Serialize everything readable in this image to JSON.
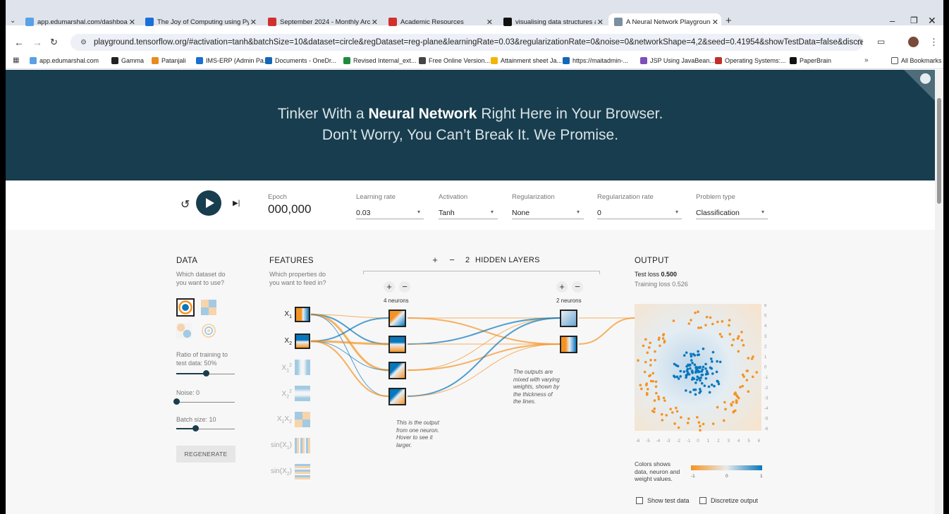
{
  "browser": {
    "tabs": [
      {
        "title": "app.edumarshal.com/dashboard",
        "color": "#5aa0e6"
      },
      {
        "title": "The Joy of Computing using Py",
        "color": "#1c6fd9"
      },
      {
        "title": "September 2024 - Monthly Arc",
        "color": "#d0312d"
      },
      {
        "title": "Academic Resources",
        "color": "#d0312d"
      },
      {
        "title": "visualising data structures and",
        "color": "#111111"
      },
      {
        "title": "A Neural Network Playground",
        "color": "#7a8fa0"
      }
    ],
    "new_tab": "+",
    "url": "playground.tensorflow.org/#activation=tanh&batchSize=10&dataset=circle&regDataset=reg-plane&learningRate=0.03&regularizationRate=0&noise=0&networkShape=4,2&seed=0.41954&showTestData=false&discretize=false&percTrainData=50&x=tr...",
    "bookmarks": [
      "app.edumarshal.com",
      "Gamma",
      "Patanjali",
      "IMS-ERP (Admin Pa...",
      "Documents - OneDr...",
      "Revised Internal_ext...",
      "Free Online Version...",
      "Attainment sheet Ja...",
      "https://maitadmin-...",
      "JSP Using JavaBean...",
      "Operating Systems:...",
      "PaperBrain"
    ],
    "all_bookmarks": "All Bookmarks"
  },
  "hero": {
    "line1_pre": "Tinker With a ",
    "line1_bold": "Neural Network",
    "line1_post": " Right Here in Your Browser.",
    "line2": "Don’t Worry, You Can’t Break It. We Promise."
  },
  "controls": {
    "epoch_label": "Epoch",
    "epoch_value": "000,000",
    "learning_rate_label": "Learning rate",
    "learning_rate": "0.03",
    "activation_label": "Activation",
    "activation": "Tanh",
    "regularization_label": "Regularization",
    "regularization": "None",
    "regularization_rate_label": "Regularization rate",
    "regularization_rate": "0",
    "problem_type_label": "Problem type",
    "problem_type": "Classification"
  },
  "data": {
    "heading": "DATA",
    "sub1": "Which dataset do",
    "sub2": "you want to use?",
    "ratio_label": "Ratio of training to",
    "ratio_label2": "test data:  50%",
    "ratio_value": 0.5,
    "noise_label": "Noise:  0",
    "noise_value": 0,
    "batch_label": "Batch size:  10",
    "batch_value": 0.33,
    "regenerate": "REGENERATE"
  },
  "features": {
    "heading": "FEATURES",
    "sub1": "Which properties do",
    "sub2": "you want to feed in?",
    "items": [
      "X",
      "X",
      "X",
      "X",
      "X",
      "sin(X",
      "sin(X"
    ]
  },
  "network": {
    "hidden_layers_count": "2",
    "hidden_layers_label": "HIDDEN LAYERS",
    "layer1_neurons": "4 neurons",
    "layer2_neurons": "2 neurons",
    "note1": [
      "This is the output",
      "from one neuron.",
      "Hover to see it",
      "larger."
    ],
    "note2": [
      "The outputs are",
      "mixed with varying",
      "weights, shown by",
      "the thickness of",
      "the lines."
    ]
  },
  "output": {
    "heading": "OUTPUT",
    "test_loss_label": "Test loss",
    "test_loss": "0.500",
    "training_loss_label": "Training loss",
    "training_loss": "0.526",
    "legend_text": [
      "Colors shows",
      "data, neuron and",
      "weight values."
    ],
    "legend_min": "-1",
    "legend_mid": "0",
    "legend_max": "1",
    "show_test_data": "Show test data",
    "discretize_output": "Discretize output",
    "x_ticks": [
      "-6",
      "-5",
      "-4",
      "-3",
      "-2",
      "-1",
      "0",
      "1",
      "2",
      "3",
      "4",
      "5",
      "6"
    ],
    "y_ticks": [
      "6",
      "5",
      "4",
      "3",
      "2",
      "1",
      "0",
      "-1",
      "-2",
      "-3",
      "-4",
      "-5",
      "-6"
    ],
    "colors": {
      "orange": "#f59322",
      "blue": "#0877bd"
    }
  }
}
